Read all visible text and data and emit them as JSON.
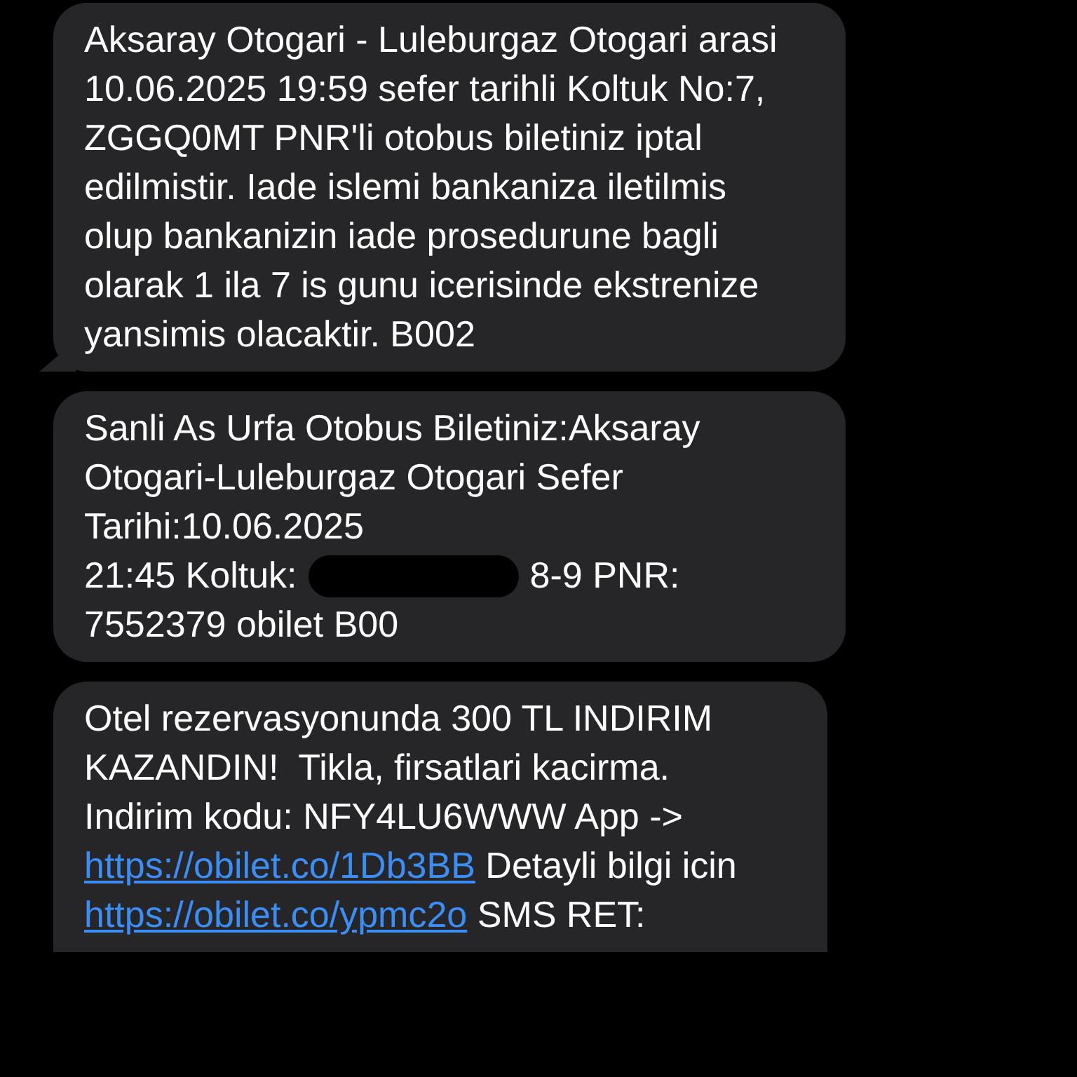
{
  "messages": [
    {
      "tail": true,
      "blocks": [
        {
          "kind": "paragraph",
          "segments": [
            {
              "kind": "text",
              "text": "Aksaray Otogari - Luleburgaz Otogari arasi 10.06.2025 19:59 sefer tarihli Koltuk No:7, ZGGQ0MT PNR'li otobus biletiniz iptal edilmistir. Iade islemi bankaniza iletilmis olup bankanizin iade prosedurune bagli olarak 1 ila 7 is gunu icerisinde ekstrenize yansimis olacaktir. B002"
            }
          ]
        }
      ]
    },
    {
      "tail": false,
      "blocks": [
        {
          "kind": "paragraph",
          "segments": [
            {
              "kind": "text",
              "text": "Sanli As Urfa Otobus Biletiniz:Aksaray Otogari-Luleburgaz Otogari Sefer Tarihi:10.06.2025"
            }
          ]
        },
        {
          "kind": "row",
          "segments": [
            {
              "kind": "text",
              "text": "21:45 Koltuk:"
            },
            {
              "kind": "redacted"
            },
            {
              "kind": "text",
              "text": "8-9 PNR:"
            }
          ]
        },
        {
          "kind": "paragraph",
          "segments": [
            {
              "kind": "text",
              "text": "7552379 obilet B00"
            }
          ]
        }
      ]
    },
    {
      "tail": false,
      "blocks": [
        {
          "kind": "paragraph",
          "segments": [
            {
              "kind": "text",
              "text": "Otel rezervasyonunda 300 TL INDIRIM KAZANDIN!  Tikla, firsatlari kacirma. Indirim kodu: NFY4LU6WWW App -> "
            },
            {
              "kind": "link",
              "text": "https://obilet.co/1Db3BB"
            },
            {
              "kind": "text",
              "text": " Detayli bilgi icin "
            },
            {
              "kind": "link",
              "text": "https://obilet.co/ypmc2o"
            },
            {
              "kind": "text",
              "text": " SMS RET:"
            }
          ]
        }
      ]
    }
  ]
}
